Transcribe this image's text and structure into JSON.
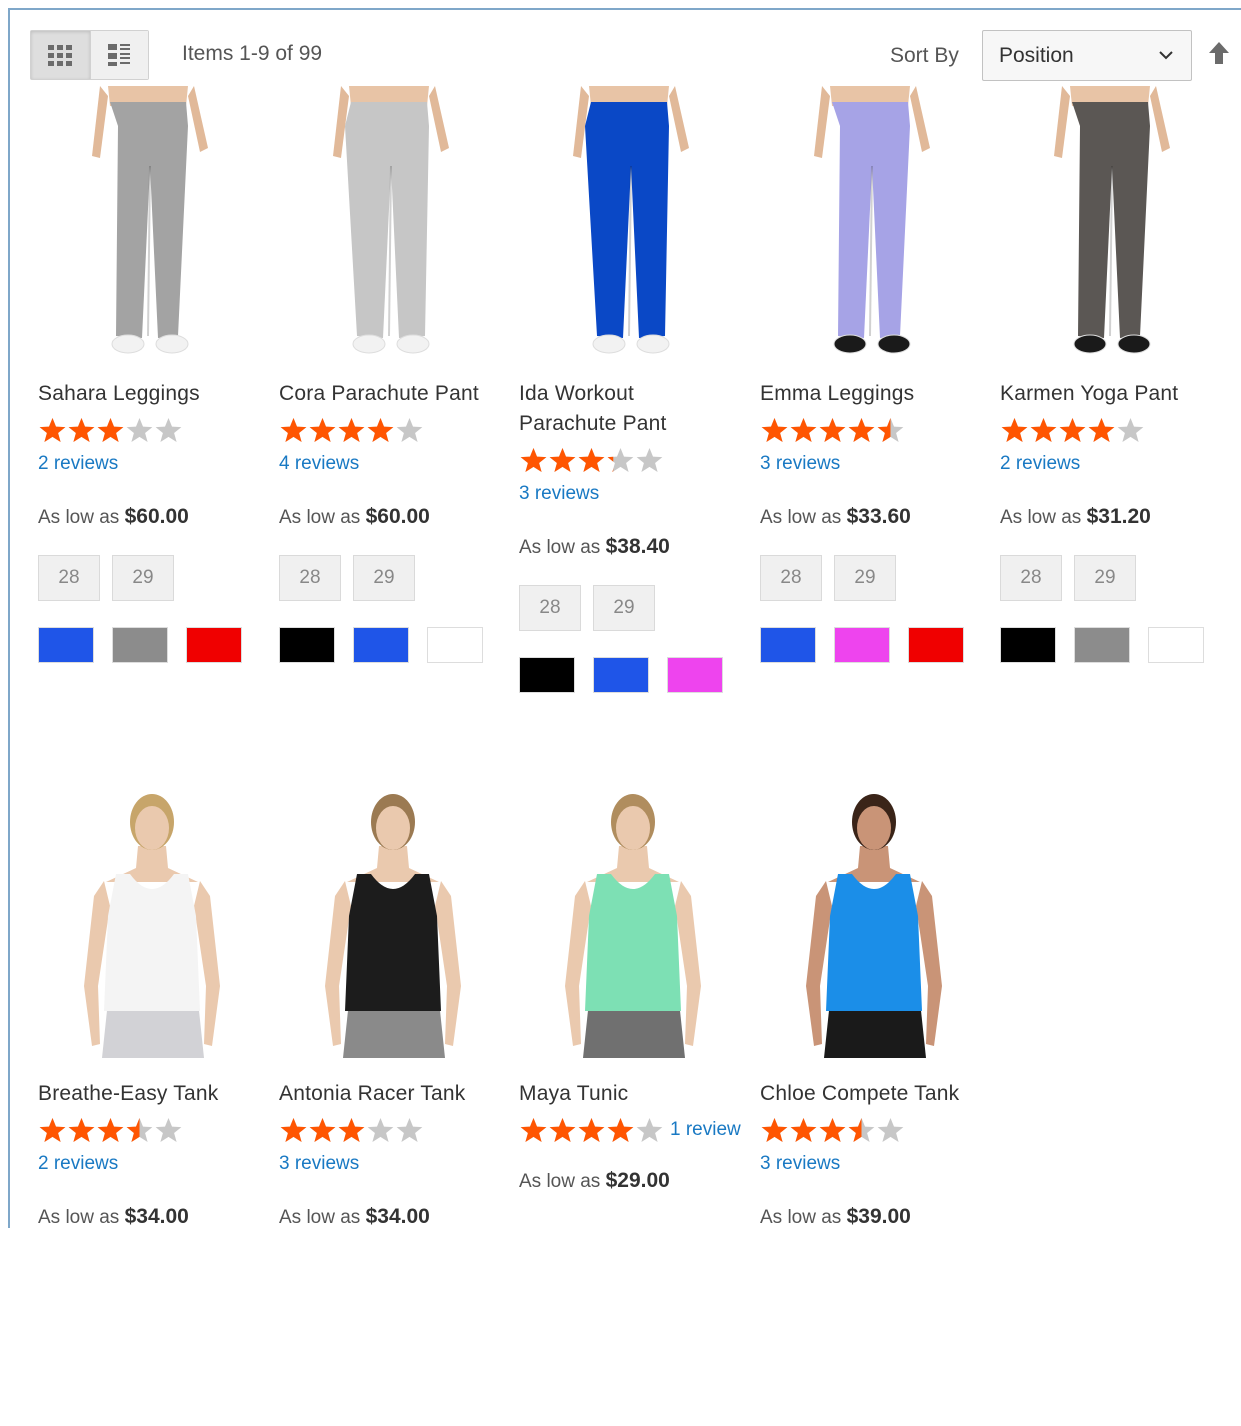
{
  "toolbar": {
    "amount": "Items 1-9 of 99",
    "sort_label": "Sort By",
    "sort_value": "Position",
    "grid_mode_icon": "grid-icon",
    "list_mode_icon": "list-icon",
    "sort_direction_icon": "arrow-up-icon"
  },
  "products": [
    {
      "name_lines": [
        "Sahara Leggings"
      ],
      "rating_pct": 60,
      "reviews": "2 reviews",
      "price_prefix": "As low as ",
      "price": "$60.00",
      "sizes": [
        "28",
        "29"
      ],
      "colors": [
        "#1f55e8",
        "#8c8c8c",
        "#f00000"
      ],
      "garment": "leggings",
      "garment_color": "#a3a3a3"
    },
    {
      "name_lines": [
        "Cora Parachute Pant"
      ],
      "rating_pct": 80,
      "reviews": "4 reviews",
      "price_prefix": "As low as ",
      "price": "$60.00",
      "sizes": [
        "28",
        "29"
      ],
      "colors": [
        "#000000",
        "#1f55e8",
        "#ffffff"
      ],
      "garment": "pants",
      "garment_color": "#c6c6c6"
    },
    {
      "name_lines": [
        "Ida Workout",
        "Parachute Pant"
      ],
      "rating_pct": 65,
      "reviews": "3 reviews",
      "price_prefix": "As low as ",
      "price": "$38.40",
      "sizes": [
        "28",
        "29"
      ],
      "colors": [
        "#000000",
        "#1f55e8",
        "#ee44ee"
      ],
      "garment": "pants",
      "garment_color": "#0a48c6"
    },
    {
      "name_lines": [
        "Emma Leggings"
      ],
      "rating_pct": 90,
      "reviews": "3 reviews",
      "price_prefix": "As low as ",
      "price": "$33.60",
      "sizes": [
        "28",
        "29"
      ],
      "colors": [
        "#1f55e8",
        "#ee44ee",
        "#f00000"
      ],
      "garment": "leggings",
      "garment_color": "#a6a3e6"
    },
    {
      "name_lines": [
        "Karmen Yoga Pant"
      ],
      "rating_pct": 80,
      "reviews": "2 reviews",
      "price_prefix": "As low as ",
      "price": "$31.20",
      "sizes": [
        "28",
        "29"
      ],
      "colors": [
        "#000000",
        "#8c8c8c",
        "#ffffff"
      ],
      "garment": "leggings",
      "garment_color": "#5b5754"
    },
    {
      "name_lines": [
        "Breathe-Easy Tank"
      ],
      "rating_pct": 70,
      "reviews": "2 reviews",
      "price_prefix": "As low as ",
      "price": "$34.00",
      "sizes": [],
      "colors": [],
      "garment": "tank",
      "garment_color": "#f4f4f4",
      "bottom_color": "#d2d2d6",
      "hair": "#c7a56a"
    },
    {
      "name_lines": [
        "Antonia Racer Tank"
      ],
      "rating_pct": 60,
      "reviews": "3 reviews",
      "price_prefix": "As low as ",
      "price": "$34.00",
      "sizes": [],
      "colors": [],
      "garment": "tank",
      "garment_color": "#1c1c1c",
      "bottom_color": "#8a8a8a",
      "hair": "#9b7a52"
    },
    {
      "name_lines": [
        "Maya Tunic"
      ],
      "rating_pct": 80,
      "reviews": "1 review",
      "reviews_inline": true,
      "price_prefix": "As low as ",
      "price": "$29.00",
      "sizes": [],
      "colors": [],
      "garment": "tank",
      "garment_color": "#7de0b4",
      "bottom_color": "#707070",
      "hair": "#b08d5e"
    },
    {
      "name_lines": [
        "Chloe Compete Tank"
      ],
      "rating_pct": 70,
      "reviews": "3 reviews",
      "price_prefix": "As low as ",
      "price": "$39.00",
      "sizes": [],
      "colors": [],
      "garment": "tank",
      "garment_color": "#1b8ee8",
      "bottom_color": "#1a1a1a",
      "hair": "#3a2418"
    }
  ],
  "theme": {
    "star_on": "#ff5501",
    "star_off": "#c7c7c7",
    "link": "#1979c3"
  }
}
